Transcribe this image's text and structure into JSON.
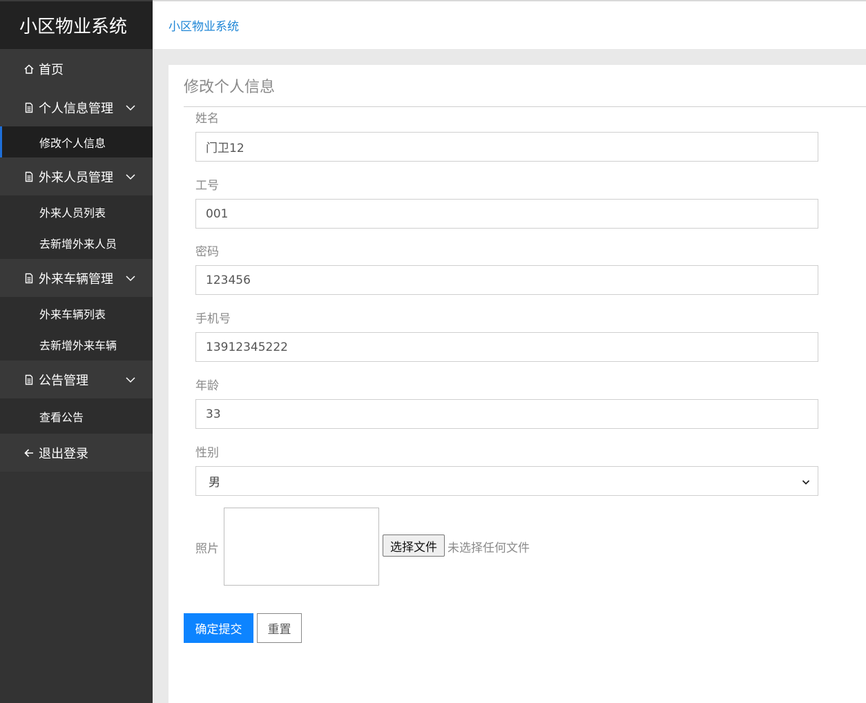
{
  "brand": {
    "title": "小区物业系统"
  },
  "breadcrumb": {
    "label": "小区物业系统"
  },
  "sidebar": {
    "home": {
      "label": "首页",
      "icon": "home-icon"
    },
    "groups": [
      {
        "label": "个人信息管理",
        "icon": "document-icon",
        "items": [
          {
            "label": "修改个人信息",
            "active": true
          }
        ]
      },
      {
        "label": "外来人员管理",
        "icon": "document-icon",
        "items": [
          {
            "label": "外来人员列表"
          },
          {
            "label": "去新增外来人员"
          }
        ]
      },
      {
        "label": "外来车辆管理",
        "icon": "document-icon",
        "items": [
          {
            "label": "外来车辆列表"
          },
          {
            "label": "去新增外来车辆"
          }
        ]
      },
      {
        "label": "公告管理",
        "icon": "document-icon",
        "items": [
          {
            "label": "查看公告"
          }
        ]
      }
    ],
    "logout": {
      "label": "退出登录",
      "icon": "arrow-left-icon"
    }
  },
  "form": {
    "title": "修改个人信息",
    "name": {
      "label": "姓名",
      "value": "门卫12"
    },
    "job_no": {
      "label": "工号",
      "value": "001"
    },
    "password": {
      "label": "密码",
      "value": "123456"
    },
    "phone": {
      "label": "手机号",
      "value": "13912345222"
    },
    "age": {
      "label": "年龄",
      "value": "33"
    },
    "gender": {
      "label": "性别",
      "value": "男"
    },
    "photo": {
      "label": "照片",
      "choose_button": "选择文件",
      "status": "未选择任何文件"
    },
    "submit_label": "确定提交",
    "reset_label": "重置"
  },
  "colors": {
    "sidebar": "#333333",
    "brand_bg": "#222222",
    "accent": "#0d84ff",
    "link": "#1f86d6"
  }
}
